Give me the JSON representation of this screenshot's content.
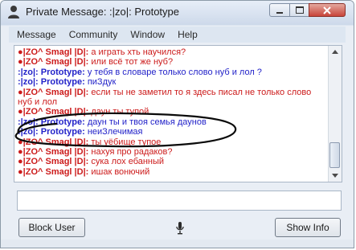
{
  "window": {
    "title": "Private Message: :|zo|: Prototype"
  },
  "menu": [
    "Message",
    "Community",
    "Window",
    "Help"
  ],
  "messages": [
    {
      "nick": "●|ZO^ Smagl |D|:",
      "text": "а играть хть научился?",
      "color": "red"
    },
    {
      "nick": "●|ZO^ Smagl |D|:",
      "text": "или всё тот же нуб?",
      "color": "red"
    },
    {
      "nick": ":|zo|: Prototype:",
      "text": "у тебя в словаре только слово нуб и лол ?",
      "color": "blue"
    },
    {
      "nick": ":|zo|: Prototype:",
      "text": "пиЗдук",
      "color": "blue"
    },
    {
      "nick": "●|ZO^ Smagl |D|:",
      "text": "если ты не заметил то я здесь писал не только слово нуб и лол",
      "color": "red"
    },
    {
      "nick": "●|ZO^ Smagl |D|:",
      "text": "даун ты тупой",
      "color": "red"
    },
    {
      "nick": ":|zo|: Prototype:",
      "text": "даун ты и твоя семья даунов",
      "color": "blue"
    },
    {
      "nick": ":|zo|: Prototype:",
      "text": "неиЗлечимая",
      "color": "blue"
    },
    {
      "nick": "●|ZO^ Smagl |D|:",
      "text": "ты уёбище тупое",
      "color": "red"
    },
    {
      "nick": "●|ZO^ Smagl |D|:",
      "text": "нахуя про радаков?",
      "color": "red"
    },
    {
      "nick": "●|ZO^ Smagl |D|:",
      "text": "сука лох ебанный",
      "color": "red"
    },
    {
      "nick": "●|ZO^ Smagl |D|:",
      "text": "ишак вонючий",
      "color": "red"
    }
  ],
  "input": {
    "value": ""
  },
  "buttons": {
    "block": "Block User",
    "info": "Show Info"
  },
  "icons": {
    "app": "user-icon",
    "mic": "microphone-icon",
    "minimize": "minimize-icon",
    "maximize": "maximize-icon",
    "close": "close-icon"
  },
  "colors": {
    "red_nick": "#cc1b1b",
    "blue_nick": "#2323c9",
    "close_button": "#c8443a"
  }
}
